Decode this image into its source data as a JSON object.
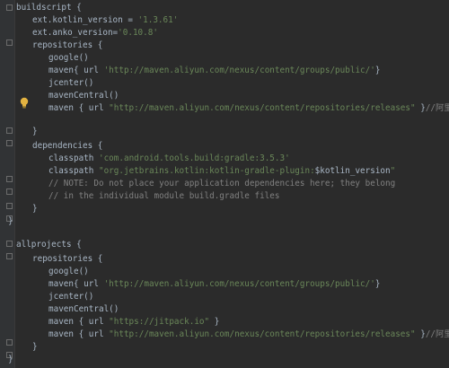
{
  "editor": {
    "lines": [
      {
        "id": "l1",
        "segs": [
          {
            "t": "buildscript {",
            "c": ""
          }
        ]
      },
      {
        "id": "l2",
        "segs": [
          {
            "t": "ext.kotlin_version = ",
            "c": ""
          },
          {
            "t": "'1.3.61'",
            "c": "str"
          }
        ]
      },
      {
        "id": "l3",
        "segs": [
          {
            "t": "ext.anko_version=",
            "c": ""
          },
          {
            "t": "'0.10.8'",
            "c": "str"
          }
        ]
      },
      {
        "id": "l4",
        "segs": [
          {
            "t": "repositories {",
            "c": ""
          }
        ]
      },
      {
        "id": "l5",
        "segs": [
          {
            "t": "google()",
            "c": ""
          }
        ]
      },
      {
        "id": "l6",
        "segs": [
          {
            "t": "maven{ url ",
            "c": ""
          },
          {
            "t": "'http://maven.aliyun.com/nexus/content/groups/public/'",
            "c": "str"
          },
          {
            "t": "}",
            "c": ""
          }
        ]
      },
      {
        "id": "l7",
        "segs": [
          {
            "t": "jcenter()",
            "c": ""
          }
        ]
      },
      {
        "id": "l8",
        "segs": [
          {
            "t": "mavenCentral()",
            "c": ""
          }
        ]
      },
      {
        "id": "l9",
        "segs": [
          {
            "t": "maven { url ",
            "c": ""
          },
          {
            "t": "\"http://maven.aliyun.com/nexus/content/repositories/releases\"",
            "c": "str"
          },
          {
            "t": " }",
            "c": ""
          },
          {
            "t": "//阿里热修复",
            "c": "comment"
          }
        ]
      },
      {
        "id": "l10",
        "segs": [
          {
            "t": "}",
            "c": ""
          }
        ]
      },
      {
        "id": "l11",
        "segs": [
          {
            "t": "dependencies {",
            "c": ""
          }
        ]
      },
      {
        "id": "l12",
        "segs": [
          {
            "t": "classpath ",
            "c": ""
          },
          {
            "t": "'com.android.tools.build:gradle:3.5.3'",
            "c": "str"
          }
        ]
      },
      {
        "id": "l13",
        "segs": [
          {
            "t": "classpath ",
            "c": ""
          },
          {
            "t": "\"org.jetbrains.kotlin:kotlin-gradle-plugin:",
            "c": "str"
          },
          {
            "t": "$kotlin_version",
            "c": "var"
          },
          {
            "t": "\"",
            "c": "str"
          }
        ]
      },
      {
        "id": "l14",
        "segs": [
          {
            "t": "// NOTE: Do not place your application dependencies here; they belong",
            "c": "comment"
          }
        ]
      },
      {
        "id": "l15",
        "segs": [
          {
            "t": "// in the individual module build.gradle files",
            "c": "comment"
          }
        ]
      },
      {
        "id": "l16",
        "segs": [
          {
            "t": "}",
            "c": ""
          }
        ]
      },
      {
        "id": "l17",
        "segs": [
          {
            "t": "}",
            "c": ""
          }
        ]
      },
      {
        "id": "l18",
        "segs": [
          {
            "t": "allprojects {",
            "c": ""
          }
        ]
      },
      {
        "id": "l19",
        "segs": [
          {
            "t": "repositories {",
            "c": ""
          }
        ]
      },
      {
        "id": "l20",
        "segs": [
          {
            "t": "google()",
            "c": ""
          }
        ]
      },
      {
        "id": "l21",
        "segs": [
          {
            "t": "maven{ url ",
            "c": ""
          },
          {
            "t": "'http://maven.aliyun.com/nexus/content/groups/public/'",
            "c": "str"
          },
          {
            "t": "}",
            "c": ""
          }
        ]
      },
      {
        "id": "l22",
        "segs": [
          {
            "t": "jcenter()",
            "c": ""
          }
        ]
      },
      {
        "id": "l23",
        "segs": [
          {
            "t": "mavenCentral()",
            "c": ""
          }
        ]
      },
      {
        "id": "l24",
        "segs": [
          {
            "t": "maven { url ",
            "c": ""
          },
          {
            "t": "\"https://jitpack.io\"",
            "c": "str"
          },
          {
            "t": " }",
            "c": ""
          }
        ]
      },
      {
        "id": "l25",
        "segs": [
          {
            "t": "maven { url ",
            "c": ""
          },
          {
            "t": "\"http://maven.aliyun.com/nexus/content/repositories/releases\"",
            "c": "str"
          },
          {
            "t": " }",
            "c": ""
          },
          {
            "t": "//阿里热修复",
            "c": "comment"
          }
        ]
      },
      {
        "id": "l26",
        "segs": [
          {
            "t": "}",
            "c": ""
          }
        ]
      },
      {
        "id": "l27",
        "segs": [
          {
            "t": "}",
            "c": ""
          }
        ]
      }
    ],
    "intention_icon": "lightbulb-icon"
  },
  "colors": {
    "background": "#2b2b2b",
    "gutter": "#313335",
    "text": "#a9b7c6",
    "string": "#6a8759",
    "comment": "#808080",
    "bulb": "#e3b341"
  }
}
